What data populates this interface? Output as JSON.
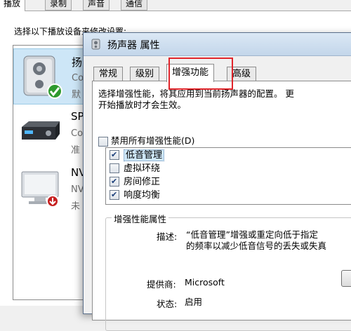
{
  "background_dialog": {
    "tabs": [
      "播放",
      "录制",
      "声音",
      "通信"
    ],
    "instruction": "选择以下播放设备来修改设置:",
    "devices": [
      {
        "name": "扬",
        "line1": "Co",
        "line2": "默",
        "icon": "speaker-icon",
        "badge": "default-check-icon"
      },
      {
        "name": "SP",
        "line1": "Co",
        "line2": "准",
        "icon": "spdif-receiver-icon"
      },
      {
        "name": "NV",
        "line1": "NV",
        "line2": "未",
        "icon": "monitor-icon",
        "badge": "disconnected-arrow-icon"
      }
    ]
  },
  "dialog": {
    "title": "扬声器 属性",
    "tabs": [
      "常规",
      "级别",
      "增强功能",
      "高级"
    ],
    "active_tab": "增强功能",
    "description_line1": "选择增强性能，将其应用到当前扬声器的配置。 更",
    "description_line2": "开始播放时才会生效。",
    "disable_all_label": "禁用所有增强性能(D)",
    "disable_all_checked": false,
    "effects": [
      {
        "label": "低音管理",
        "checked": true,
        "selected": true
      },
      {
        "label": "虚拟环绕",
        "checked": false,
        "selected": false
      },
      {
        "label": "房间修正",
        "checked": true,
        "selected": false
      },
      {
        "label": "响度均衡",
        "checked": true,
        "selected": false
      }
    ],
    "properties_group_title": "增强性能属性",
    "description_label": "描述:",
    "description_value_line1": "“低音管理”增强或重定向低于指定",
    "description_value_line2": "的频率以减少低音信号的丢失或失真",
    "provider_label": "提供商:",
    "provider_value": "Microsoft",
    "status_label": "状态:",
    "status_value": "启用"
  },
  "colors": {
    "highlight_box": "#e0242a",
    "selection": "#cde6f7",
    "titlebar": "#c3d6ea"
  }
}
